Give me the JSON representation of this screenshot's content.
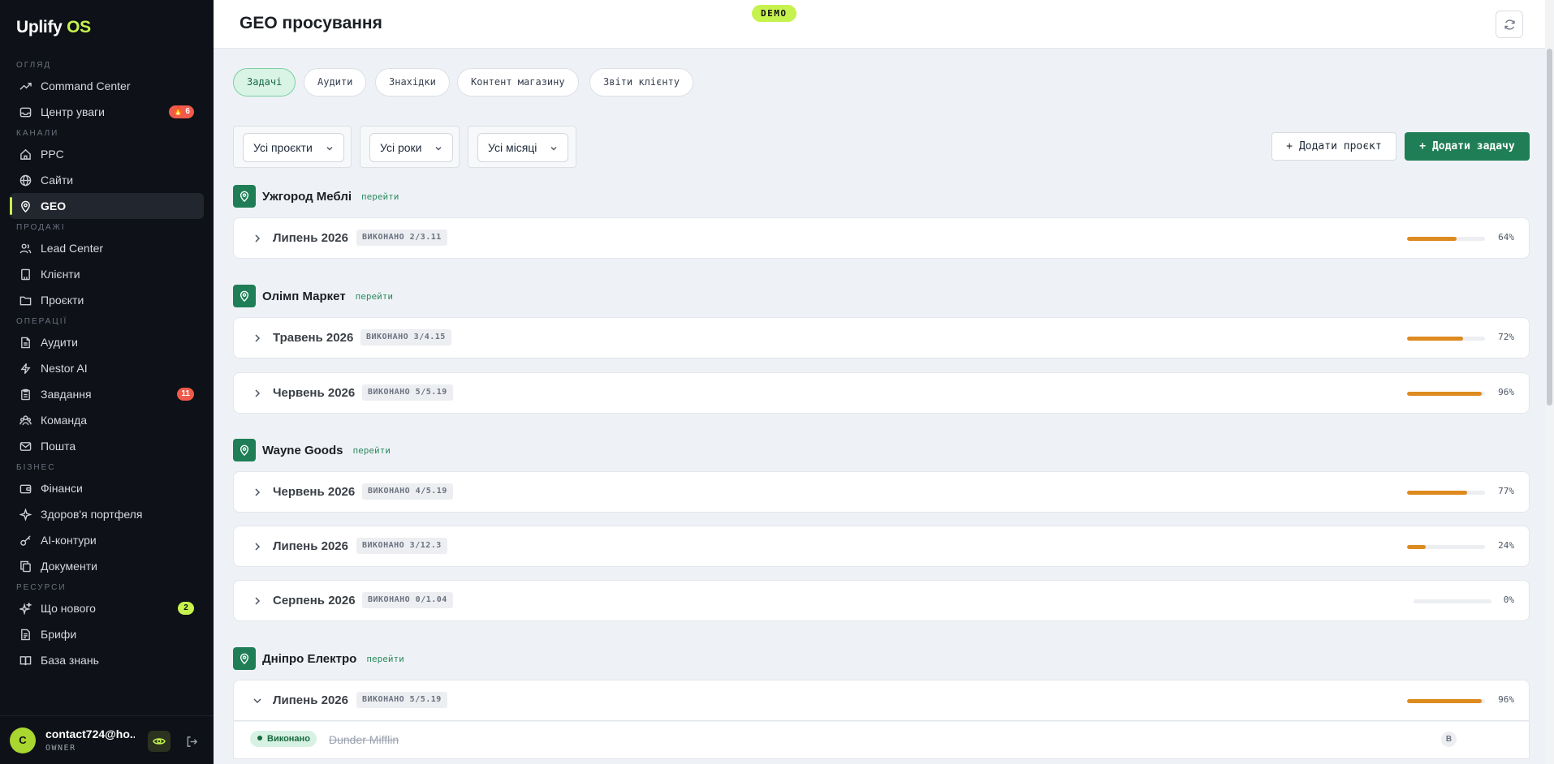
{
  "app": {
    "logo_main": "Uplify",
    "logo_accent": "OS"
  },
  "sidebar": {
    "sections": {
      "overview": "ОГЛЯД",
      "channels": "КАНАЛИ",
      "sales": "ПРОДАЖІ",
      "operations": "ОПЕРАЦІЇ",
      "business": "БІЗНЕС",
      "resources": "РЕСУРСИ"
    },
    "items": {
      "command_center": "Command Center",
      "attention": "Центр уваги",
      "attention_badge": "🔥 6",
      "ppc": "PPC",
      "sites": "Сайти",
      "geo": "GEO",
      "lead_center": "Lead Center",
      "clients": "Клієнти",
      "projects": "Проєкти",
      "audits": "Аудити",
      "nestor": "Nestor AI",
      "tasks": "Завдання",
      "tasks_badge": "11",
      "team": "Команда",
      "mail": "Пошта",
      "finance": "Фінанси",
      "portfolio": "Здоров'я портфеля",
      "ai_circuits": "AI-контури",
      "documents": "Документи",
      "whats_new": "Що нового",
      "whats_new_badge": "2",
      "briefs": "Брифи",
      "knowledge": "База знань"
    },
    "user": {
      "initial": "C",
      "email": "contact724@ho...",
      "role": "OWNER"
    }
  },
  "header": {
    "title": "GEO просування",
    "demo": "DEMO"
  },
  "tabs": [
    "Задачі",
    "Аудити",
    "Знахідки",
    "Контент магазину",
    "Звіти клієнту"
  ],
  "filters": {
    "projects": "Усі проєкти",
    "years": "Усі роки",
    "months": "Усі місяці"
  },
  "actions": {
    "add_project": "Додати проєкт",
    "add_task": "Додати задачу"
  },
  "groups": [
    {
      "name": "Ужгород Меблі",
      "link": "перейти",
      "months": [
        {
          "label": "Липень 2026",
          "done": "ВИКОНАНО 2/3.11",
          "progress": 64,
          "pct": "64%"
        }
      ]
    },
    {
      "name": "Олімп Маркет",
      "link": "перейти",
      "months": [
        {
          "label": "Травень 2026",
          "done": "ВИКОНАНО 3/4.15",
          "progress": 72,
          "pct": "72%"
        },
        {
          "label": "Червень 2026",
          "done": "ВИКОНАНО 5/5.19",
          "progress": 96,
          "pct": "96%"
        }
      ]
    },
    {
      "name": "Wayne Goods",
      "link": "перейти",
      "months": [
        {
          "label": "Червень 2026",
          "done": "ВИКОНАНО 4/5.19",
          "progress": 77,
          "pct": "77%"
        },
        {
          "label": "Липень 2026",
          "done": "ВИКОНАНО 3/12.3",
          "progress": 24,
          "pct": "24%"
        },
        {
          "label": "Серпень 2026",
          "done": "ВИКОНАНО 0/1.04",
          "progress": 0,
          "pct": "0%"
        }
      ]
    },
    {
      "name": "Дніпро Електро",
      "link": "перейти",
      "months": [
        {
          "label": "Липень 2026",
          "done": "ВИКОНАНО 5/5.19",
          "progress": 96,
          "pct": "96%"
        }
      ]
    }
  ],
  "task": {
    "status": "Виконано",
    "name": "Dunder Mifflin",
    "assignee": "B"
  },
  "colors": {
    "accent": "#c6f24e",
    "primary": "#1f7e55",
    "progress": "#dd8a1f",
    "sidebar_bg": "#0e1117"
  }
}
